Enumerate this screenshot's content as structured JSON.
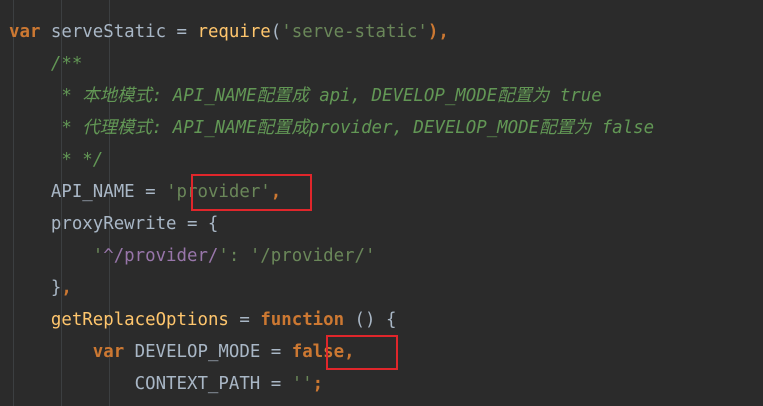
{
  "lines": [
    {
      "segments": [
        {
          "t": "var",
          "c": "kw"
        },
        {
          "t": " serveStatic = ",
          "c": "plain"
        },
        {
          "t": "require",
          "c": "fn"
        },
        {
          "t": "(",
          "c": "plain"
        },
        {
          "t": "'serve-static'",
          "c": "str"
        },
        {
          "t": "),",
          "c": "kw"
        }
      ]
    },
    {
      "segments": [
        {
          "t": "    /**",
          "c": "cm"
        }
      ]
    },
    {
      "segments": [
        {
          "t": "     * 本地模式: API_NAME配置成 api, DEVELOP_MODE配置为 true",
          "c": "cm"
        }
      ]
    },
    {
      "segments": [
        {
          "t": "     * 代理模式: API_NAME配置成provider, DEVELOP_MODE配置为 false",
          "c": "cm"
        }
      ]
    },
    {
      "segments": [
        {
          "t": "     * */",
          "c": "cm"
        }
      ]
    },
    {
      "segments": [
        {
          "t": "    API_NAME = ",
          "c": "plain"
        },
        {
          "t": "'provider'",
          "c": "str"
        },
        {
          "t": ",",
          "c": "kw"
        }
      ]
    },
    {
      "segments": [
        {
          "t": "    proxyRewrite = {",
          "c": "plain"
        }
      ]
    },
    {
      "segments": [
        {
          "t": "        '",
          "c": "str"
        },
        {
          "t": "^/provider/",
          "c": "strp"
        },
        {
          "t": "': '/provider/'",
          "c": "str"
        }
      ]
    },
    {
      "segments": [
        {
          "t": "    }",
          "c": "plain"
        },
        {
          "t": ",",
          "c": "kw"
        }
      ]
    },
    {
      "segments": [
        {
          "t": "    ",
          "c": "plain"
        },
        {
          "t": "getReplaceOptions",
          "c": "fn"
        },
        {
          "t": " = ",
          "c": "plain"
        },
        {
          "t": "function",
          "c": "kw"
        },
        {
          "t": " () {",
          "c": "plain"
        }
      ]
    },
    {
      "segments": [
        {
          "t": "        ",
          "c": "plain"
        },
        {
          "t": "var",
          "c": "kw"
        },
        {
          "t": " DEVELOP_MODE = ",
          "c": "plain"
        },
        {
          "t": "false",
          "c": "kw"
        },
        {
          "t": ",",
          "c": "kw"
        }
      ]
    },
    {
      "segments": [
        {
          "t": "            CONTEXT_PATH = ",
          "c": "plain"
        },
        {
          "t": "''",
          "c": "str"
        },
        {
          "t": ";",
          "c": "kw"
        }
      ]
    }
  ],
  "colors": {
    "background": "#2b2b2b",
    "keyword": "#cc7832",
    "string": "#6a8759",
    "comment": "#629755",
    "function": "#ffc66d",
    "highlight_box": "#e0262b"
  }
}
